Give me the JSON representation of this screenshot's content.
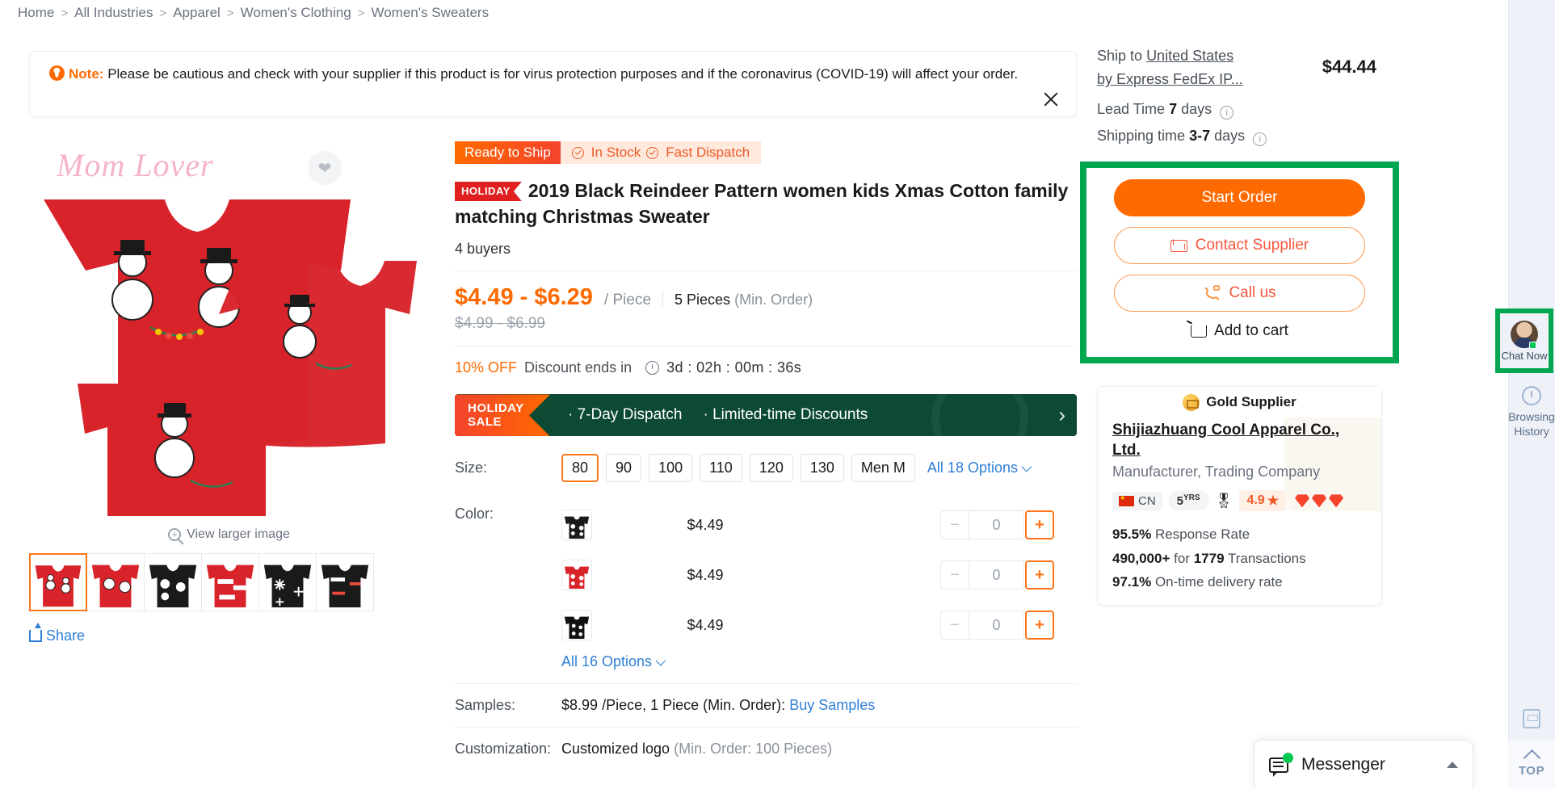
{
  "breadcrumb": {
    "items": [
      "Home",
      "All Industries",
      "Apparel",
      "Women's Clothing",
      "Women's Sweaters"
    ],
    "separator": ">"
  },
  "note": {
    "label": "Note:",
    "text": "Please be cautious and check with your supplier if this product is for virus protection purposes and if the coronavirus (COVID-19) will affect your order.",
    "icon": "lightbulb-icon",
    "close_icon": "close-icon"
  },
  "gallery": {
    "watermark": "Mom Lover",
    "view_larger": "View larger image",
    "share": "Share",
    "wishlist_icon": "heart-icon",
    "thumbnails": [
      {
        "name": "red-snowman-sweater",
        "selected": true
      },
      {
        "name": "red-santa-sweater",
        "selected": false
      },
      {
        "name": "black-snowman-sweater",
        "selected": false
      },
      {
        "name": "red-text-sweater",
        "selected": false
      },
      {
        "name": "black-snowflake-sweater",
        "selected": false
      },
      {
        "name": "black-dad-sweater",
        "selected": false
      }
    ]
  },
  "product": {
    "ready_to_ship": "Ready to Ship",
    "in_stock": "In Stock",
    "fast_dispatch": "Fast Dispatch",
    "holiday_tag": "HOLIDAY",
    "title": "2019 Black Reindeer Pattern women kids Xmas Cotton family matching Christmas Sweater",
    "buyers": "4 buyers",
    "price_range": "$4.49 - $6.29",
    "price_unit": "/ Piece",
    "moq_qty": "5 Pieces",
    "moq_label": "(Min. Order)",
    "price_old": "$4.99 - $6.99",
    "discount_pct": "10% OFF",
    "discount_label": "Discount ends in",
    "countdown": "3d : 02h : 00m : 36s"
  },
  "holiday_banner": {
    "tag_line1": "HOLIDAY",
    "tag_line2": "SALE",
    "benefit1": "· 7-Day Dispatch",
    "benefit2": "· Limited-time Discounts",
    "arrow_icon": "chevron-right-icon"
  },
  "options": {
    "size_label": "Size:",
    "sizes": [
      {
        "label": "80",
        "selected": true
      },
      {
        "label": "90",
        "selected": false
      },
      {
        "label": "100",
        "selected": false
      },
      {
        "label": "110",
        "selected": false
      },
      {
        "label": "120",
        "selected": false
      },
      {
        "label": "130",
        "selected": false
      },
      {
        "label": "Men M",
        "selected": false
      }
    ],
    "size_all": "All 18 Options",
    "color_label": "Color:",
    "colors": [
      {
        "swatch": "black-sweater-swatch",
        "price": "$4.49",
        "qty": "0"
      },
      {
        "swatch": "red-sweater-swatch",
        "price": "$4.49",
        "qty": "0"
      },
      {
        "swatch": "black-sweater-swatch-2",
        "price": "$4.49",
        "qty": "0"
      }
    ],
    "color_all": "All 16 Options",
    "minus_label": "−",
    "plus_label": "+"
  },
  "samples": {
    "label": "Samples:",
    "price": "$8.99",
    "unit": "/Piece, 1 Piece",
    "min_order": "(Min. Order):",
    "buy_link": "Buy Samples"
  },
  "customization": {
    "label": "Customization:",
    "value": "Customized logo",
    "min_order": "(Min. Order: 100 Pieces)"
  },
  "shipping": {
    "ship_to_prefix": "Ship to",
    "country": "United States",
    "method_prefix": "by",
    "method": "Express FedEx IP...",
    "price": "$44.44",
    "lead_time_label": "Lead Time",
    "lead_time_value": "7",
    "lead_time_unit": "days",
    "shipping_time_label": "Shipping time",
    "shipping_time_value": "3-7",
    "shipping_time_unit": "days",
    "info_icon": "info-icon"
  },
  "cta": {
    "start_order": "Start Order",
    "contact_supplier": "Contact Supplier",
    "call_us": "Call us",
    "add_to_cart": "Add to cart",
    "envelope_icon": "envelope-icon",
    "phone_icon": "phone-icon",
    "cart_icon": "shopping-cart-icon",
    "highlight_color": "#00a650"
  },
  "supplier": {
    "gold_badge": "Gold Supplier",
    "name": "Shijiazhuang Cool Apparel Co., Ltd.",
    "type": "Manufacturer, Trading Company",
    "country_code": "CN",
    "years": "5",
    "years_sup": "YRS",
    "rating": "4.9",
    "star": "★",
    "diamonds": 3,
    "response_rate_value": "95.5%",
    "response_rate_label": "Response Rate",
    "transactions_value": "490,000+",
    "transactions_mid": "for",
    "transactions_count": "1779",
    "transactions_label": "Transactions",
    "ontime_value": "97.1%",
    "ontime_label": "On-time delivery rate"
  },
  "rail": {
    "chat_now": "Chat Now",
    "browsing_history_line1": "Browsing",
    "browsing_history_line2": "History",
    "top": "TOP",
    "note_icon": "note-edit-icon",
    "clock_icon": "clock-icon",
    "up_icon": "chevron-up-icon"
  },
  "messenger": {
    "label": "Messenger",
    "icon": "chat-bubble-icon",
    "collapse_icon": "caret-up-icon"
  },
  "colors": {
    "accent_orange": "#ff6a00",
    "link_blue": "#2f7fd6",
    "highlight_green": "#00a650",
    "holiday_green": "#0c4a33",
    "red": "#e02020"
  }
}
